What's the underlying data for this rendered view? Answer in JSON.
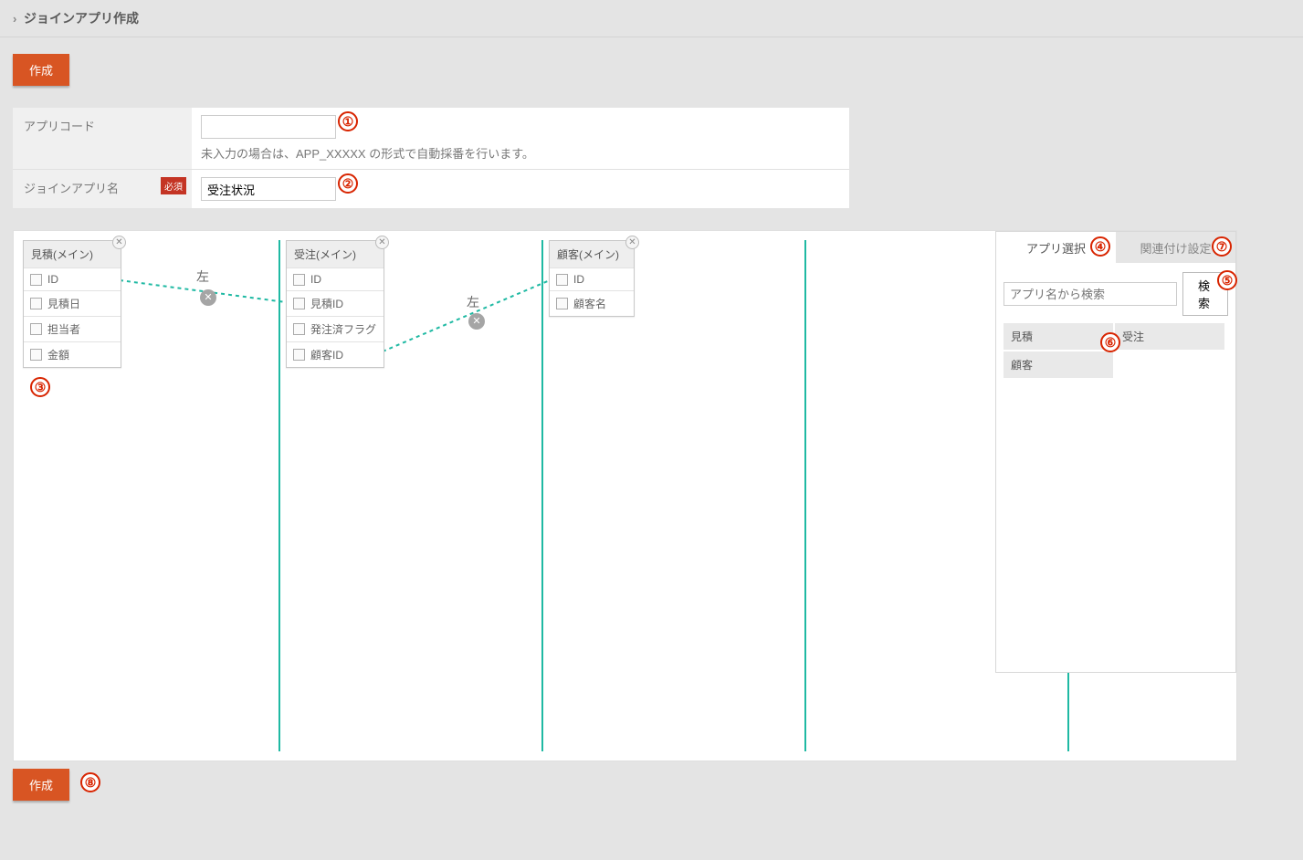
{
  "header": {
    "title": "ジョインアプリ作成"
  },
  "buttons": {
    "create": "作成",
    "search": "検 索"
  },
  "form": {
    "app_code_label": "アプリコード",
    "app_code_value": "",
    "app_code_help": "未入力の場合は、APP_XXXXX の形式で自動採番を行います。",
    "join_name_label": "ジョインアプリ名",
    "join_name_required": "必須",
    "join_name_value": "受注状況"
  },
  "entities": [
    {
      "title": "見積(メイン)",
      "fields": [
        "ID",
        "見積日",
        "担当者",
        "金額"
      ]
    },
    {
      "title": "受注(メイン)",
      "fields": [
        "ID",
        "見積ID",
        "発注済フラグ",
        "顧客ID"
      ]
    },
    {
      "title": "顧客(メイン)",
      "fields": [
        "ID",
        "顧客名"
      ]
    }
  ],
  "links": [
    {
      "label": "左"
    },
    {
      "label": "左"
    }
  ],
  "sidebar": {
    "tab_select": "アプリ選択",
    "tab_relation": "関連付け設定",
    "search_placeholder": "アプリ名から検索",
    "results": [
      "見積",
      "受注",
      "顧客"
    ]
  },
  "annotations": [
    "①",
    "②",
    "③",
    "④",
    "⑤",
    "⑥",
    "⑦",
    "⑧"
  ]
}
